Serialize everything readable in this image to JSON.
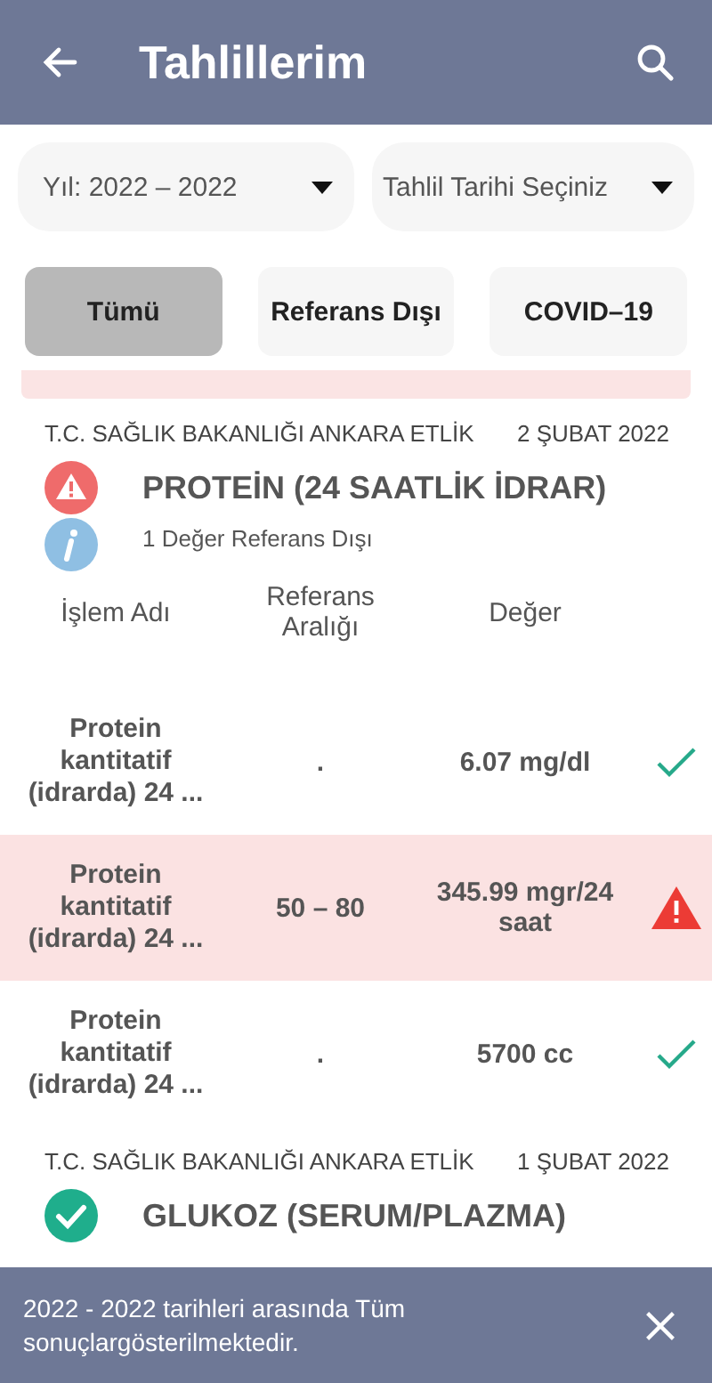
{
  "header": {
    "title": "Tahlillerim"
  },
  "filters": [
    {
      "label": "Yıl: 2022 – 2022"
    },
    {
      "label": "Tahlil Tarihi Seçiniz"
    }
  ],
  "tabs": [
    {
      "label": "Tümü",
      "selected": true
    },
    {
      "label": "Referans Dışı",
      "selected": false
    },
    {
      "label": "COVID–19",
      "selected": false
    }
  ],
  "results": [
    {
      "hospital": "T.C. SAĞLIK BAKANLIĞI ANKARA ETLİK",
      "date": "2 ŞUBAT 2022",
      "test": "PROTEİN (24 SAATLİK İDRAR)",
      "kind": "alert",
      "info": "1 Değer Referans Dışı",
      "columns": [
        "İşlem Adı",
        "Referans Aralığı",
        "Değer"
      ],
      "rows": [
        {
          "name": "Protein kantitatif (idrarda) 24 ...",
          "range": ".",
          "value": "6.07 mg/dl",
          "kind": "normal"
        },
        {
          "name": "Protein kantitatif (idrarda) 24 ...",
          "range": "50 – 80",
          "value": "345.99 mgr/24 saat",
          "kind": "high"
        },
        {
          "name": "Protein kantitatif (idrarda) 24 ...",
          "range": ".",
          "value": "5700 cc",
          "kind": "normal"
        }
      ]
    },
    {
      "hospital": "T.C. SAĞLIK BAKANLIĞI ANKARA ETLİK",
      "date": "1 ŞUBAT 2022",
      "test": "GLUKOZ (SERUM/PLAZMA)",
      "kind": "ok"
    }
  ],
  "snackbar": {
    "message": "2022 - 2022 tarihleri arasında Tüm sonuçlargösterilmektedir."
  }
}
